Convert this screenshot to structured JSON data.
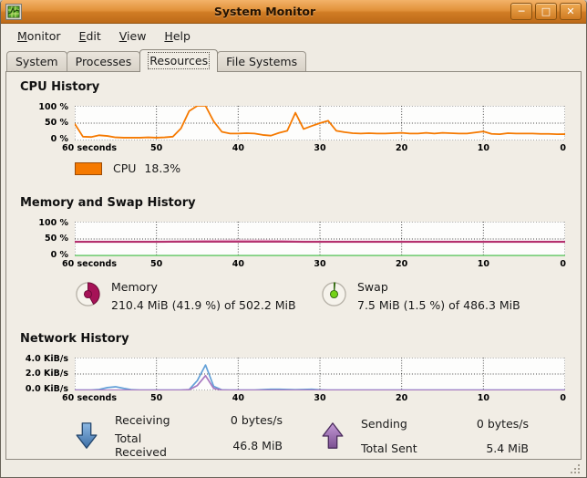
{
  "window": {
    "title": "System Monitor"
  },
  "icons": {
    "minimize": "─",
    "maximize": "□",
    "close": "✕"
  },
  "menu": {
    "items": [
      {
        "key": "M",
        "rest": "onitor"
      },
      {
        "key": "E",
        "rest": "dit"
      },
      {
        "key": "V",
        "rest": "iew"
      },
      {
        "key": "H",
        "rest": "elp"
      }
    ]
  },
  "tabs": {
    "items": [
      "System",
      "Processes",
      "Resources",
      "File Systems"
    ],
    "active": "Resources"
  },
  "axes": {
    "time": [
      "60 seconds",
      "50",
      "40",
      "30",
      "20",
      "10",
      "0"
    ],
    "percent": [
      "100 %",
      "50 %",
      "0 %"
    ],
    "net": [
      "4.0 KiB/s",
      "2.0 KiB/s",
      "0.0 KiB/s"
    ]
  },
  "cpu_section": {
    "title": "CPU History",
    "legend_label": "CPU",
    "legend_value": "18.3%"
  },
  "memory_section": {
    "title": "Memory and Swap History",
    "memory": {
      "name": "Memory",
      "detail": "210.4 MiB (41.9 %) of 502.2 MiB",
      "percent": 41.9,
      "pie_fill": "#a61257",
      "pie_stroke": "#6d0b38"
    },
    "swap": {
      "name": "Swap",
      "detail": "7.5 MiB (1.5 %) of 486.3 MiB",
      "percent": 1.5,
      "pie_fill": "#73d216",
      "pie_stroke": "#336b11"
    }
  },
  "network_section": {
    "title": "Network History",
    "receiving_label": "Receiving",
    "receiving_value": "0 bytes/s",
    "total_received_label": "Total Received",
    "total_received_value": "46.8 MiB",
    "sending_label": "Sending",
    "sending_value": "0 bytes/s",
    "total_sent_label": "Total Sent",
    "total_sent_value": "5.4 MiB"
  },
  "colors": {
    "cpu": "#f57900",
    "memory": "#a61257",
    "memory_light": "#e79fc4",
    "swap": "#7ecf7e",
    "net_in": "#62a0d8",
    "net_out": "#a879c0",
    "arrow_in": "#5b93cc",
    "arrow_out": "#9e66b8"
  },
  "charts": {
    "cpu": {
      "type": "line",
      "ymax": 100,
      "x_range_seconds": [
        60,
        0
      ],
      "series": [
        {
          "name": "cpu",
          "color": "#f57900",
          "width": 1.8,
          "values": [
            48,
            11,
            10,
            15,
            13,
            9,
            8,
            8,
            8,
            9,
            8,
            9,
            11,
            35,
            85,
            100,
            100,
            55,
            25,
            20,
            20,
            21,
            20,
            16,
            14,
            22,
            28,
            80,
            33,
            42,
            50,
            57,
            28,
            24,
            21,
            20,
            21,
            20,
            20,
            21,
            22,
            20,
            20,
            22,
            20,
            22,
            21,
            20,
            20,
            23,
            26,
            19,
            18,
            21,
            20,
            20,
            20,
            19,
            19,
            18,
            18.3
          ]
        }
      ]
    },
    "memswap": {
      "type": "line",
      "ymax": 100,
      "x_range_seconds": [
        60,
        0
      ],
      "series": [
        {
          "name": "memory-peak",
          "color": "#e79fc4",
          "width": 2.4,
          "values": [
            41.9,
            41.9,
            41.9,
            41.9,
            41.9,
            41.9,
            41.9,
            41.9,
            41.9,
            41.9,
            42,
            42.4,
            42.8,
            43.2,
            43.6,
            44,
            44.2,
            44.5,
            44.7,
            44.9,
            45,
            45,
            45,
            44.9,
            44.7,
            44.3,
            43.6,
            42.6,
            41.9,
            41.9,
            41.9,
            41.9,
            41.9,
            41.9,
            41.9,
            41.9,
            41.9,
            41.9,
            41.9,
            41.9,
            41.9,
            41.9,
            41.9,
            41.9,
            41.9,
            41.9,
            41.9,
            41.9,
            41.9,
            41.9,
            41.9,
            41.9,
            41.9,
            41.9,
            41.9,
            41.9,
            41.9,
            41.9,
            41.9,
            41.9,
            41.9
          ]
        },
        {
          "name": "memory",
          "color": "#a61257",
          "width": 1.7,
          "flat": 41.9
        },
        {
          "name": "swap",
          "color": "#7ecf7e",
          "width": 2.4,
          "flat": 1.5
        }
      ]
    },
    "net": {
      "type": "line",
      "ymax": 4.0,
      "x_range_seconds": [
        60,
        0
      ],
      "series": [
        {
          "name": "receiving",
          "color": "#62a0d8",
          "width": 1.7,
          "values": [
            0.05,
            0.05,
            0.05,
            0.12,
            0.35,
            0.45,
            0.25,
            0.08,
            0.05,
            0.05,
            0.05,
            0.05,
            0.05,
            0.05,
            0.1,
            1.2,
            3.1,
            0.5,
            0.07,
            0.05,
            0.05,
            0.05,
            0.05,
            0.1,
            0.15,
            0.15,
            0.12,
            0.08,
            0.12,
            0.14,
            0.07,
            0.05,
            0.05,
            0.05,
            0.05,
            0.05,
            0.05,
            0.05,
            0.05,
            0.05,
            0.05,
            0.05,
            0.05,
            0.05,
            0.05,
            0.05,
            0.05,
            0.05,
            0.05,
            0.05,
            0.05,
            0.05,
            0.05,
            0.05,
            0.05,
            0.05,
            0.05,
            0.05,
            0.05,
            0.05,
            0.05
          ]
        },
        {
          "name": "sending",
          "color": "#a879c0",
          "width": 1.7,
          "values": [
            0.03,
            0.03,
            0.03,
            0.03,
            0.03,
            0.03,
            0.03,
            0.03,
            0.03,
            0.03,
            0.03,
            0.03,
            0.03,
            0.03,
            0.08,
            0.6,
            1.8,
            0.25,
            0.05,
            0.03,
            0.03,
            0.03,
            0.03,
            0.03,
            0.03,
            0.03,
            0.03,
            0.03,
            0.03,
            0.03,
            0.03,
            0.03,
            0.03,
            0.03,
            0.03,
            0.03,
            0.03,
            0.03,
            0.03,
            0.03,
            0.03,
            0.03,
            0.03,
            0.03,
            0.03,
            0.03,
            0.03,
            0.03,
            0.03,
            0.03,
            0.03,
            0.03,
            0.03,
            0.03,
            0.03,
            0.03,
            0.03,
            0.03,
            0.03,
            0.03,
            0.03
          ]
        }
      ]
    }
  }
}
